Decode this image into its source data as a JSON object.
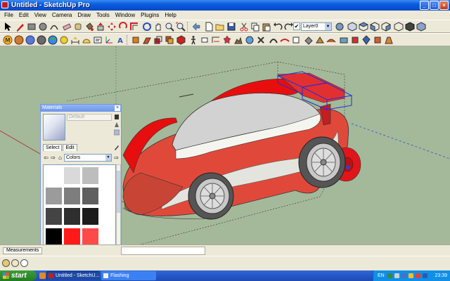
{
  "window": {
    "title": "Untitled - SketchUp Pro",
    "controls": [
      "minimize",
      "maximize",
      "close"
    ]
  },
  "menu": [
    "File",
    "Edit",
    "View",
    "Camera",
    "Draw",
    "Tools",
    "Window",
    "Plugins",
    "Help"
  ],
  "layers_toolbar": {
    "checkmark": "✔",
    "current_layer": "Layer0"
  },
  "materials_panel": {
    "title": "Materials",
    "material_name": "Default",
    "tabs": [
      "Select",
      "Edit"
    ],
    "library": "Colors",
    "swatch_colors": [
      [
        "#ffffff",
        "#d9d9d9",
        "#bdbdbd"
      ],
      [
        "#9b9b9b",
        "#7d7d7d",
        "#5f5f5f"
      ],
      [
        "#444444",
        "#2e2e2e",
        "#1c1c1c"
      ],
      [
        "#000000",
        "#ff1a1a",
        "#ff4a4a"
      ],
      [
        "#ff6f6f",
        "#ff9a9a",
        "#ffc8c8"
      ]
    ]
  },
  "measurements": {
    "label": "Measurements",
    "value": ""
  },
  "taskbar": {
    "start_label": "start",
    "tasks": [
      "Untitled - SketchU...",
      "Flashing"
    ],
    "language": "EN",
    "clock": "23:39"
  },
  "colors": {
    "viewport_bg": "#a4b99a",
    "car_body": "#e63a2e",
    "car_roof": "#d9d9d9",
    "selection_blue": "#1f2fe0"
  }
}
